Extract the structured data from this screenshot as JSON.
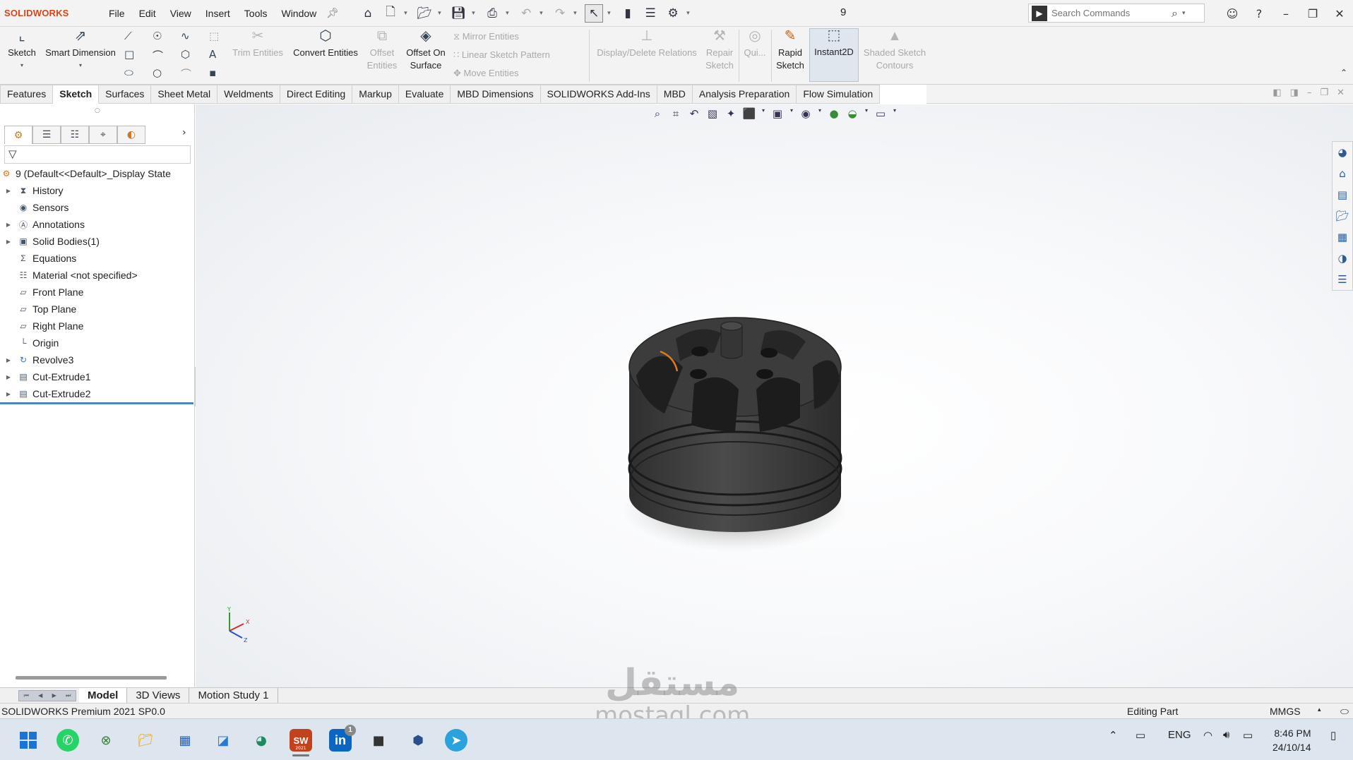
{
  "app": {
    "logo_text": "SOLIDWORKS",
    "document_title": "9",
    "menus": [
      "File",
      "Edit",
      "View",
      "Insert",
      "Tools",
      "Window"
    ],
    "search_placeholder": "Search Commands"
  },
  "commands": {
    "sketch": "Sketch",
    "smart_dimension": "Smart Dimension",
    "trim_entities": "Trim Entities",
    "convert_entities": "Convert Entities",
    "offset_entities_1": "Offset",
    "offset_entities_2": "Entities",
    "offset_on_surface_1": "Offset On",
    "offset_on_surface_2": "Surface",
    "mirror_entities": "Mirror Entities",
    "linear_sketch_pattern": "Linear Sketch Pattern",
    "move_entities": "Move Entities",
    "display_delete_relations": "Display/Delete Relations",
    "repair_sketch_1": "Repair",
    "repair_sketch_2": "Sketch",
    "quick_snaps": "Qui...",
    "rapid_sketch_1": "Rapid",
    "rapid_sketch_2": "Sketch",
    "instant2d": "Instant2D",
    "shaded_sketch_contours_1": "Shaded Sketch",
    "shaded_sketch_contours_2": "Contours"
  },
  "tabs": [
    "Features",
    "Sketch",
    "Surfaces",
    "Sheet Metal",
    "Weldments",
    "Direct Editing",
    "Markup",
    "Evaluate",
    "MBD Dimensions",
    "SOLIDWORKS Add-Ins",
    "MBD",
    "Analysis Preparation",
    "Flow Simulation"
  ],
  "active_tab": "Sketch",
  "tree": {
    "root": "9  (Default<<Default>_Display State",
    "items": [
      {
        "label": "History",
        "icon": "history-icon",
        "expandable": true
      },
      {
        "label": "Sensors",
        "icon": "sensors-icon",
        "expandable": false
      },
      {
        "label": "Annotations",
        "icon": "annotations-icon",
        "expandable": true
      },
      {
        "label": "Solid Bodies(1)",
        "icon": "solid-bodies-icon",
        "expandable": true
      },
      {
        "label": "Equations",
        "icon": "equations-icon",
        "expandable": false
      },
      {
        "label": "Material <not specified>",
        "icon": "material-icon",
        "expandable": false
      },
      {
        "label": "Front Plane",
        "icon": "plane-icon",
        "expandable": false
      },
      {
        "label": "Top Plane",
        "icon": "plane-icon",
        "expandable": false
      },
      {
        "label": "Right Plane",
        "icon": "plane-icon",
        "expandable": false
      },
      {
        "label": "Origin",
        "icon": "origin-icon",
        "expandable": false
      },
      {
        "label": "Revolve3",
        "icon": "revolve-icon",
        "expandable": true
      },
      {
        "label": "Cut-Extrude1",
        "icon": "cut-extrude-icon",
        "expandable": true
      },
      {
        "label": "Cut-Extrude2",
        "icon": "cut-extrude-icon",
        "expandable": true
      }
    ]
  },
  "triad": {
    "x": "X",
    "y": "Y",
    "z": "Z"
  },
  "bottom_tabs": [
    "Model",
    "3D Views",
    "Motion Study 1"
  ],
  "status": {
    "product": "SOLIDWORKS Premium 2021 SP0.0",
    "mode": "Editing Part",
    "units": "MMGS"
  },
  "taskbar": {
    "language": "ENG",
    "time": "8:46 PM",
    "date": "24/10/14",
    "linkedin_badge": "1",
    "sw_label": "2021"
  },
  "watermark": {
    "arabic": "مستقل",
    "latin": "mostaql.com"
  },
  "colors": {
    "accent": "#d6451b",
    "model": "#3f3f3f",
    "selection": "#4a86c8"
  }
}
